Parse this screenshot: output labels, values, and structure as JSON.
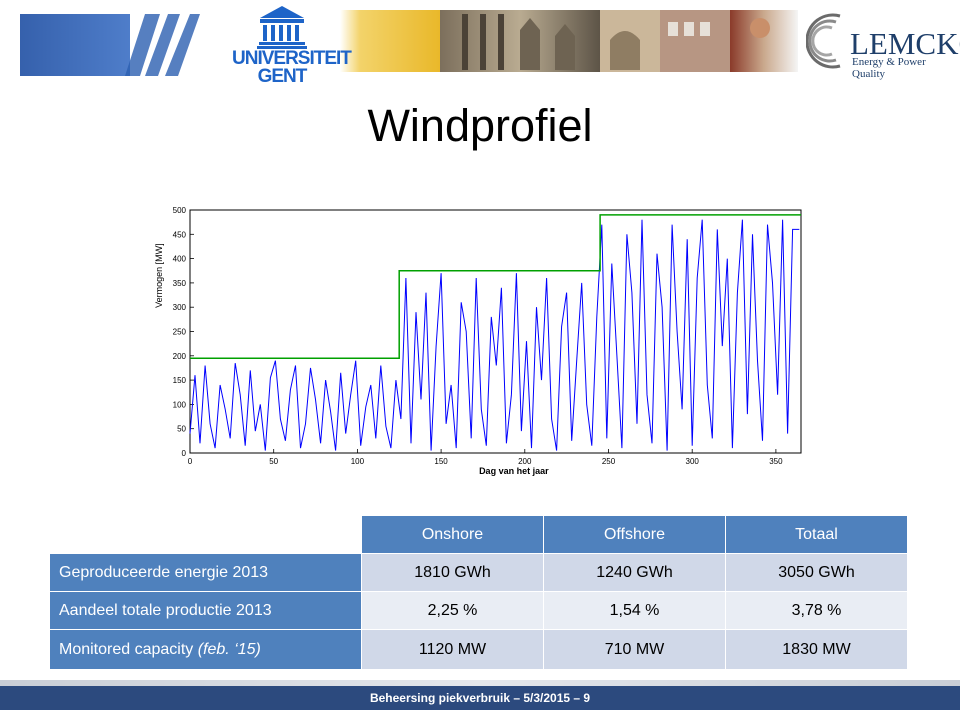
{
  "slide": {
    "title": "Windprofiel",
    "footer": "Beheersing piekverbruik – 5/3/2015 – 9"
  },
  "logos": {
    "university_line1": "UNIVERSITEIT",
    "university_line2": "GENT",
    "company_name": "LEMCKO",
    "company_tagline": "Energy & Power Quality"
  },
  "colors": {
    "table_header": "#4f81bd",
    "row_dark": "#d0d8e8",
    "row_light": "#e9edf4",
    "row_label": "#1f4e9c",
    "footer": "#2c4a7e",
    "wind_line": "#0000ff",
    "capacity_line": "#00a000"
  },
  "chart_data": {
    "type": "line",
    "title": "",
    "xlabel": "Dag van het jaar",
    "ylabel": "Vermogen [MW]",
    "xlim": [
      0,
      365
    ],
    "ylim": [
      0,
      500
    ],
    "xticks": [
      0,
      50,
      100,
      150,
      200,
      250,
      300,
      350
    ],
    "yticks": [
      0,
      50,
      100,
      150,
      200,
      250,
      300,
      350,
      400,
      450,
      500
    ],
    "grid": false,
    "series": [
      {
        "name": "",
        "color": "#00a000",
        "x": [
          0,
          125,
          125,
          245,
          245,
          365
        ],
        "values": [
          195,
          195,
          375,
          375,
          490,
          490
        ]
      },
      {
        "name": "",
        "color": "#0000ff",
        "x": [
          0,
          3,
          6,
          9,
          12,
          15,
          18,
          21,
          24,
          27,
          30,
          33,
          36,
          39,
          42,
          45,
          48,
          51,
          54,
          57,
          60,
          63,
          66,
          69,
          72,
          75,
          78,
          81,
          84,
          87,
          90,
          93,
          96,
          99,
          102,
          105,
          108,
          111,
          114,
          117,
          120,
          123,
          126,
          129,
          132,
          135,
          138,
          141,
          144,
          147,
          150,
          153,
          156,
          159,
          162,
          165,
          168,
          171,
          174,
          177,
          180,
          183,
          186,
          189,
          192,
          195,
          198,
          201,
          204,
          207,
          210,
          213,
          216,
          219,
          222,
          225,
          228,
          231,
          234,
          237,
          240,
          243,
          246,
          249,
          252,
          255,
          258,
          261,
          264,
          267,
          270,
          273,
          276,
          279,
          282,
          285,
          288,
          291,
          294,
          297,
          300,
          303,
          306,
          309,
          312,
          315,
          318,
          321,
          324,
          327,
          330,
          333,
          336,
          339,
          342,
          345,
          348,
          351,
          354,
          357,
          360,
          364
        ],
        "values": [
          40,
          160,
          20,
          180,
          60,
          10,
          140,
          90,
          30,
          185,
          120,
          15,
          170,
          45,
          100,
          5,
          155,
          190,
          70,
          25,
          130,
          180,
          10,
          60,
          175,
          110,
          20,
          150,
          85,
          5,
          165,
          40,
          120,
          190,
          15,
          95,
          140,
          30,
          180,
          55,
          10,
          150,
          70,
          360,
          20,
          290,
          110,
          330,
          5,
          220,
          370,
          60,
          140,
          10,
          310,
          250,
          30,
          360,
          90,
          15,
          280,
          180,
          340,
          20,
          120,
          370,
          45,
          230,
          10,
          300,
          150,
          360,
          70,
          5,
          260,
          330,
          25,
          190,
          350,
          100,
          15,
          280,
          470,
          30,
          390,
          200,
          10,
          450,
          330,
          60,
          480,
          120,
          20,
          410,
          300,
          5,
          470,
          250,
          90,
          440,
          15,
          360,
          480,
          140,
          30,
          460,
          220,
          400,
          10,
          330,
          480,
          80,
          450,
          190,
          25,
          470,
          350,
          120,
          480,
          40,
          460,
          460
        ]
      }
    ]
  },
  "table": {
    "headers": [
      "Onshore",
      "Offshore",
      "Totaal"
    ],
    "rows": [
      {
        "label": "Geproduceerde energie 2013",
        "label_extra": "",
        "values": [
          "1810 GWh",
          "1240 GWh",
          "3050 GWh"
        ]
      },
      {
        "label": "Aandeel totale productie 2013",
        "label_extra": "",
        "values": [
          "2,25 %",
          "1,54 %",
          "3,78 %"
        ]
      },
      {
        "label": "Monitored capacity ",
        "label_extra": "(feb. ‘15)",
        "values": [
          "1120 MW",
          "710 MW",
          "1830 MW"
        ]
      }
    ]
  }
}
